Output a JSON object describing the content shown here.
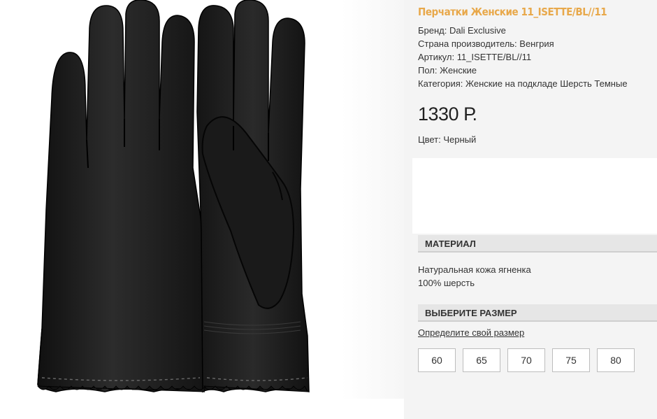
{
  "product": {
    "title": "Перчатки Женские 11_ISETTE/BL//11",
    "specs": [
      "Бренд: Dali Exclusive",
      "Страна производитель: Венгрия",
      "Артикул: 11_ISETTE/BL//11",
      "Пол: Женские",
      "Категория: Женские на подкладе Шерсть Темные"
    ],
    "price": "1330 Р.",
    "color_line": "Цвет: Черный"
  },
  "material": {
    "header": "МАТЕРИАЛ",
    "lines": [
      "Натуральная кожа ягненка",
      "100% шерсть"
    ]
  },
  "size": {
    "header": "ВЫБЕРИТЕ РАЗМЕР",
    "link": "Определите свой размер",
    "options": [
      "60",
      "65",
      "70",
      "75",
      "80"
    ]
  },
  "colors": {
    "title": "#e8a84a",
    "panel_bg": "#f4f4f4",
    "header_bg": "#e6e6e6",
    "glove": "#1e1e1e"
  }
}
